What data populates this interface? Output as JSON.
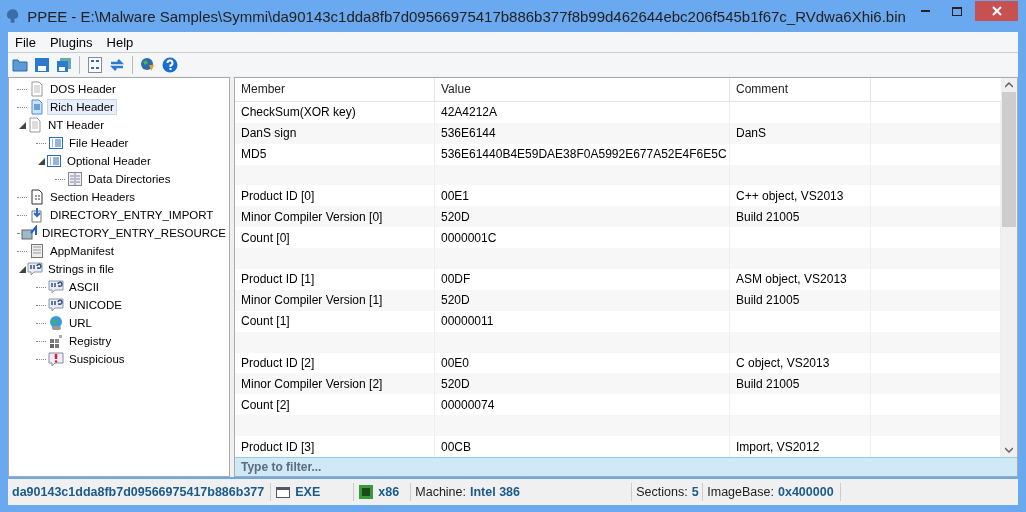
{
  "window": {
    "title": "PPEE - E:\\Malware Samples\\Symmi\\da90143c1dda8fb7d09566975417b886b377f8b99d462644ebc206f545b1f67c_RVdwa6Xhi6.bin"
  },
  "menu": [
    {
      "label": "File"
    },
    {
      "label": "Plugins"
    },
    {
      "label": "Help"
    }
  ],
  "tree": [
    {
      "label": "DOS Header",
      "selected": false
    },
    {
      "label": "Rich Header",
      "selected": true
    },
    {
      "label": "NT Header",
      "selected": false,
      "expanded": true,
      "children": [
        {
          "label": "File Header",
          "selected": false
        },
        {
          "label": "Optional Header",
          "selected": false,
          "expanded": true,
          "children": [
            {
              "label": "Data Directories",
              "selected": false
            }
          ]
        }
      ]
    },
    {
      "label": "Section Headers",
      "selected": false
    },
    {
      "label": "DIRECTORY_ENTRY_IMPORT",
      "selected": false
    },
    {
      "label": "DIRECTORY_ENTRY_RESOURCE",
      "selected": false
    },
    {
      "label": "AppManifest",
      "selected": false
    },
    {
      "label": "Strings in file",
      "selected": false,
      "expanded": true,
      "children": [
        {
          "label": "ASCII",
          "selected": false
        },
        {
          "label": "UNICODE",
          "selected": false
        },
        {
          "label": "URL",
          "selected": false
        },
        {
          "label": "Registry",
          "selected": false
        },
        {
          "label": "Suspicious",
          "selected": false
        }
      ]
    }
  ],
  "table": {
    "columns": [
      "Member",
      "Value",
      "Comment"
    ],
    "rows": [
      {
        "kind": "data",
        "member": "CheckSum(XOR key)",
        "value": "42A4212A"
      },
      {
        "kind": "data",
        "member": "DanS sign",
        "value": "536E6144",
        "comment": "DanS"
      },
      {
        "kind": "data",
        "member": "MD5",
        "value": "536E61440B4E59DAE38F0A5992E677A52E4F6E5C"
      },
      {
        "kind": "blank"
      },
      {
        "kind": "data",
        "member": "Product ID [0]",
        "value": "00E1",
        "comment": "C++ object, VS2013"
      },
      {
        "kind": "data",
        "member": "Minor Compiler Version [0]",
        "value": "520D",
        "comment": "Build 21005"
      },
      {
        "kind": "data",
        "member": "Count [0]",
        "value": "0000001C"
      },
      {
        "kind": "blank"
      },
      {
        "kind": "data",
        "member": "Product ID [1]",
        "value": "00DF",
        "comment": "ASM object, VS2013"
      },
      {
        "kind": "data",
        "member": "Minor Compiler Version [1]",
        "value": "520D",
        "comment": "Build 21005"
      },
      {
        "kind": "data",
        "member": "Count [1]",
        "value": "00000011"
      },
      {
        "kind": "blank"
      },
      {
        "kind": "data",
        "member": "Product ID [2]",
        "value": "00E0",
        "comment": "C object, VS2013"
      },
      {
        "kind": "data",
        "member": "Minor Compiler Version [2]",
        "value": "520D",
        "comment": "Build 21005"
      },
      {
        "kind": "data",
        "member": "Count [2]",
        "value": "00000074"
      },
      {
        "kind": "blank"
      },
      {
        "kind": "data",
        "member": "Product ID [3]",
        "value": "00CB",
        "comment": "Import, VS2012"
      }
    ]
  },
  "filter": {
    "placeholder": "Type to filter..."
  },
  "status_bar": [
    {
      "kind": "hash",
      "value": "da90143c1dda8fb7d09566975417b886b377"
    },
    {
      "kind": "type",
      "value": "EXE"
    },
    {
      "kind": "arch",
      "value": "x86"
    },
    {
      "kind": "field",
      "label": "Machine:",
      "value": "Intel 386"
    },
    {
      "kind": "field",
      "label": "Sections:",
      "value": "5"
    },
    {
      "kind": "field",
      "label": "ImageBase:",
      "value": "0x400000"
    }
  ]
}
